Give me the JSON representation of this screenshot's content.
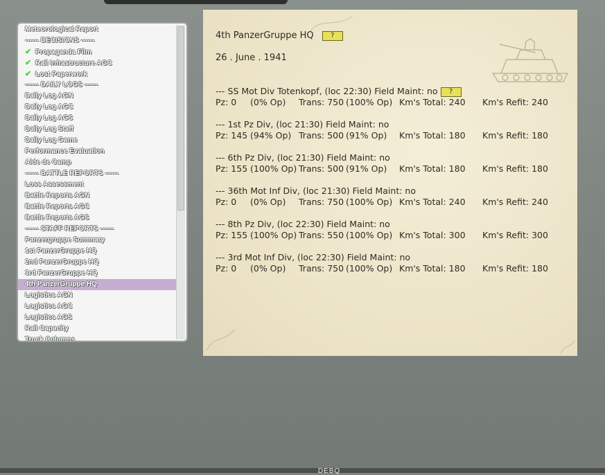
{
  "sidebar": {
    "items": [
      {
        "label": "Meteorological Report",
        "checked": false
      },
      {
        "label": "------ DECISIONS ------",
        "checked": false
      },
      {
        "label": "Propaganda Film",
        "checked": true
      },
      {
        "label": "Rail Infrastructure AGC",
        "checked": true
      },
      {
        "label": "Lost Paperwork",
        "checked": true
      },
      {
        "label": "------ DAILY LOGS ------",
        "checked": false
      },
      {
        "label": "Daily Log AGN",
        "checked": false
      },
      {
        "label": "Daily Log AGC",
        "checked": false
      },
      {
        "label": "Daily Log AGS",
        "checked": false
      },
      {
        "label": "Daily Log Staff",
        "checked": false
      },
      {
        "label": "Daily Log Game",
        "checked": false
      },
      {
        "label": "Performance Evaluation",
        "checked": false
      },
      {
        "label": "Aide de Camp",
        "checked": false
      },
      {
        "label": "------ BATTLE REPORTS ------",
        "checked": false
      },
      {
        "label": "Loss Assessment",
        "checked": false
      },
      {
        "label": "Battle Reports AGN",
        "checked": false
      },
      {
        "label": "Battle Reports AGC",
        "checked": false
      },
      {
        "label": "Battle Reports AGS",
        "checked": false
      },
      {
        "label": "------ STAFF REPORTS ------",
        "checked": false
      },
      {
        "label": "Panzergruppe Summary",
        "checked": false
      },
      {
        "label": "1st PanzerGruppe HQ",
        "checked": false
      },
      {
        "label": "2nd PanzerGruppe HQ",
        "checked": false
      },
      {
        "label": "3rd PanzerGruppe HQ",
        "checked": false
      },
      {
        "label": "4th PanzerGruppe HQ",
        "checked": false,
        "selected": true
      },
      {
        "label": "Logistics AGN",
        "checked": false
      },
      {
        "label": "Logistics AGC",
        "checked": false
      },
      {
        "label": "Logistics AGS",
        "checked": false
      },
      {
        "label": "Rail Capacity",
        "checked": false
      },
      {
        "label": "Truck Columns",
        "checked": false
      }
    ]
  },
  "report": {
    "title": "4th PanzerGruppe HQ",
    "help_label": "?",
    "date": "26 . June . 1941",
    "units": [
      {
        "header": "--- SS Mot Div Totenkopf, (loc 22:30) Field Maint: no",
        "help": true,
        "pz": "Pz: 0",
        "pz_op": "(0% Op)",
        "trans": "Trans: 750",
        "trans_op": "(100% Op)",
        "km_total": "Km's Total: 240",
        "km_refit": "Km's Refit: 240"
      },
      {
        "header": "--- 1st Pz Div, (loc 21:30) Field Maint: no",
        "help": false,
        "pz": "Pz: 145",
        "pz_op": "(94% Op)",
        "trans": "Trans: 500",
        "trans_op": "(91% Op)",
        "km_total": "Km's Total: 180",
        "km_refit": "Km's Refit: 180"
      },
      {
        "header": "--- 6th Pz Div, (loc 21:30) Field Maint: no",
        "help": false,
        "pz": "Pz: 155",
        "pz_op": "(100% Op)",
        "trans": "Trans: 500",
        "trans_op": "(91% Op)",
        "km_total": "Km's Total: 180",
        "km_refit": "Km's Refit: 180"
      },
      {
        "header": "--- 36th Mot Inf Div, (loc 21:30) Field Maint: no",
        "help": false,
        "pz": "Pz: 0",
        "pz_op": "(0% Op)",
        "trans": "Trans: 750",
        "trans_op": "(100% Op)",
        "km_total": "Km's Total: 240",
        "km_refit": "Km's Refit: 240"
      },
      {
        "header": "--- 8th Pz Div, (loc 22:30) Field Maint: no",
        "help": false,
        "pz": "Pz: 155",
        "pz_op": "(100% Op)",
        "trans": "Trans: 550",
        "trans_op": "(100% Op)",
        "km_total": "Km's Total: 300",
        "km_refit": "Km's Refit: 300"
      },
      {
        "header": "--- 3rd Mot Inf Div, (loc 22:30) Field Maint: no",
        "help": false,
        "pz": "Pz: 0",
        "pz_op": "(0% Op)",
        "trans": "Trans: 750",
        "trans_op": "(100% Op)",
        "km_total": "Km's Total: 180",
        "km_refit": "Km's Refit: 180"
      }
    ]
  },
  "footer": {
    "tab_label": "DEBQ"
  }
}
